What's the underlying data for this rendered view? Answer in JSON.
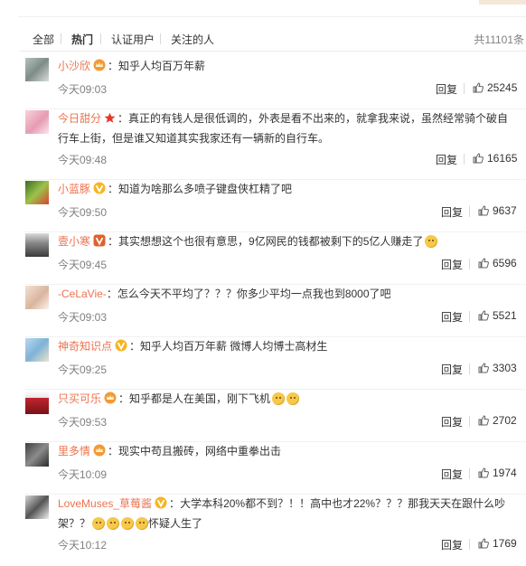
{
  "filters": [
    "全部",
    "热门",
    "认证用户",
    "关注的人"
  ],
  "total": "共11101条",
  "reply_label": "回复",
  "comments": [
    {
      "user": "小沙欣",
      "badge": "crown",
      "text": "知乎人均百万年薪",
      "time": "今天09:03",
      "likes": "25245",
      "avatar": "grey"
    },
    {
      "user": "今日甜分",
      "badge": "star",
      "text": "真正的有钱人是很低调的，外表是看不出来的，就拿我来说，虽然经常骑个破自行车上街，但是谁又知道其实我家还有一辆新的自行车。",
      "time": "今天09:48",
      "likes": "16165",
      "avatar": "pink"
    },
    {
      "user": "小蓝豚",
      "badge": "v",
      "text": "知道为啥那么多喷子键盘侠杠精了吧",
      "time": "今天09:50",
      "likes": "9637",
      "avatar": "green"
    },
    {
      "user": "壹小寒",
      "badge": "vred",
      "text": "其实想想这个也很有意思，9亿网民的钱都被剩下的5亿人赚走了",
      "time": "今天09:45",
      "likes": "6596",
      "avatar": "dark"
    },
    {
      "user": "-CeLaVie-",
      "badge": "",
      "text": "怎么今天不平均了？？？你多少平均一点我也到8000了吧",
      "time": "今天09:03",
      "likes": "5521",
      "avatar": "girl"
    },
    {
      "user": "神奇知识点",
      "badge": "v",
      "text": "知乎人均百万年薪 微博人均博士高材生",
      "time": "今天09:25",
      "likes": "3303",
      "avatar": "cat"
    },
    {
      "user": "只买可乐",
      "badge": "crown",
      "text": "知乎都是人在美国，刚下飞机",
      "time": "今天09:53",
      "likes": "2702",
      "avatar": "cola"
    },
    {
      "user": "里多情",
      "badge": "crown",
      "text": "现实中苟且搬砖，网络中重拳出击",
      "time": "今天10:09",
      "likes": "1974",
      "avatar": "face"
    },
    {
      "user": "LoveMuses_草莓酱",
      "badge": "v",
      "text": "大学本科20%都不到？！！高中也才22%？？？那我天天在跟什么吵架？？",
      "text2": "怀疑人生了",
      "time": "今天10:12",
      "likes": "1769",
      "avatar": "girl2"
    }
  ],
  "icons": {
    "like": "thumbs-up-icon",
    "crown": "crown-badge-icon",
    "v": "verified-v-icon",
    "star": "star-badge-icon",
    "emoji": "emoji-icon"
  },
  "colors": {
    "username": "#eb7350",
    "meta": "#808080"
  }
}
